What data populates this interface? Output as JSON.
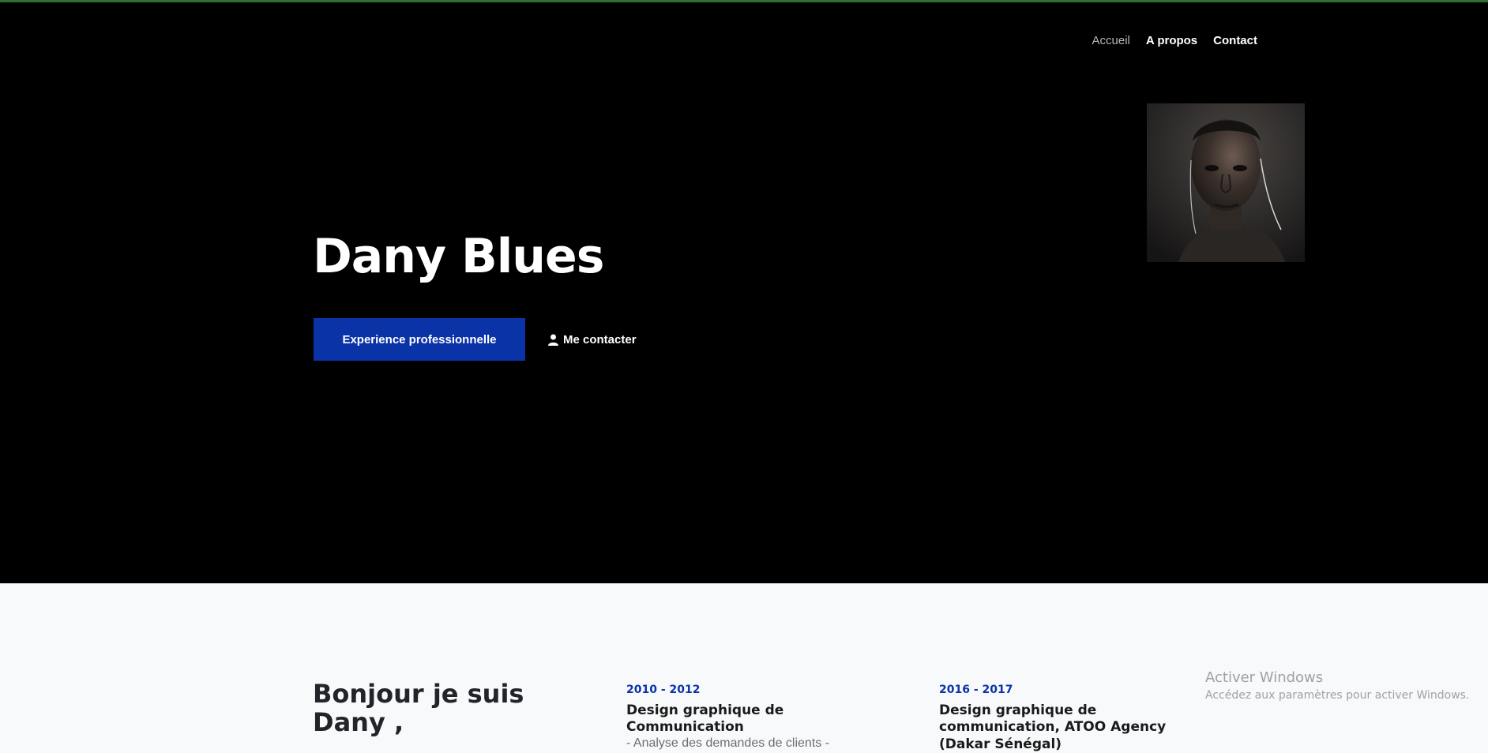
{
  "nav": {
    "items": [
      {
        "label": "Accueil",
        "active": true
      },
      {
        "label": "A propos",
        "active": false
      },
      {
        "label": "Contact",
        "active": false
      }
    ]
  },
  "hero": {
    "name": "Dany Blues",
    "primary_button": "Experience professionnelle",
    "contact_button": "Me contacter",
    "contact_icon": "user-icon"
  },
  "about": {
    "title": "Bonjour je suis Dany ,",
    "timeline": [
      {
        "years": "2010 - 2012",
        "title": "Design graphique de Communication",
        "desc": "- Analyse des demandes de clients -"
      },
      {
        "years": "2016 - 2017",
        "title": "Design graphique de communication, ATOO Agency (Dakar Sénégal)"
      }
    ]
  },
  "watermark": {
    "line1": "Activer Windows",
    "line2": "Accédez aux paramètres pour activer Windows."
  },
  "colors": {
    "accent": "#0b33a8",
    "hero_bg": "#000000",
    "page_bg": "#f8f9fa",
    "top_border": "#2f6f2f"
  }
}
